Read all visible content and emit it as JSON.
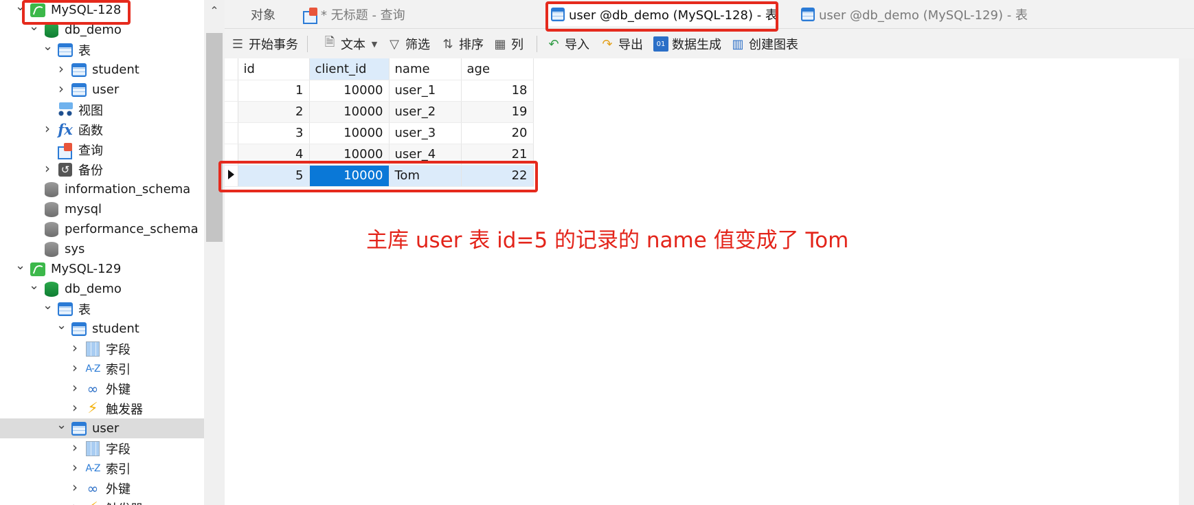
{
  "sidebar": {
    "nodes": [
      {
        "label": "MySQL-128",
        "icon": "mysql-server-icon",
        "chevron": "expanded"
      },
      {
        "label": "db_demo",
        "icon": "database-icon",
        "chevron": "expanded"
      },
      {
        "label": "表",
        "icon": "tables-folder-icon",
        "chevron": "expanded"
      },
      {
        "label": "student",
        "icon": "table-icon",
        "chevron": "collapsed"
      },
      {
        "label": "user",
        "icon": "table-icon",
        "chevron": "collapsed"
      },
      {
        "label": "视图",
        "icon": "views-folder-icon",
        "chevron": ""
      },
      {
        "label": "函数",
        "icon": "function-icon",
        "chevron": "collapsed"
      },
      {
        "label": "查询",
        "icon": "query-icon",
        "chevron": ""
      },
      {
        "label": "备份",
        "icon": "backup-icon",
        "chevron": "collapsed"
      },
      {
        "label": "information_schema",
        "icon": "database-icon-grey",
        "chevron": ""
      },
      {
        "label": "mysql",
        "icon": "database-icon-grey",
        "chevron": ""
      },
      {
        "label": "performance_schema",
        "icon": "database-icon-grey",
        "chevron": ""
      },
      {
        "label": "sys",
        "icon": "database-icon-grey",
        "chevron": ""
      },
      {
        "label": "MySQL-129",
        "icon": "mysql-server-icon",
        "chevron": "expanded"
      },
      {
        "label": "db_demo",
        "icon": "database-icon",
        "chevron": "expanded"
      },
      {
        "label": "表",
        "icon": "tables-folder-icon",
        "chevron": "expanded"
      },
      {
        "label": "student",
        "icon": "table-icon",
        "chevron": "expanded"
      },
      {
        "label": "字段",
        "icon": "fields-icon",
        "chevron": "collapsed"
      },
      {
        "label": "索引",
        "icon": "index-icon",
        "chevron": "collapsed"
      },
      {
        "label": "外键",
        "icon": "foreign-key-icon",
        "chevron": "collapsed"
      },
      {
        "label": "触发器",
        "icon": "trigger-icon",
        "chevron": "collapsed"
      },
      {
        "label": "user",
        "icon": "table-icon",
        "chevron": "expanded",
        "selected": true
      },
      {
        "label": "字段",
        "icon": "fields-icon",
        "chevron": "collapsed"
      },
      {
        "label": "索引",
        "icon": "index-icon",
        "chevron": "collapsed"
      },
      {
        "label": "外键",
        "icon": "foreign-key-icon",
        "chevron": "collapsed"
      },
      {
        "label": "触发器",
        "icon": "trigger-icon",
        "chevron": "collapsed"
      }
    ],
    "az_glyph": "A-Z"
  },
  "tabs": {
    "objects": "对象",
    "untitled_query": "* 无标题 - 查询",
    "user_128": "user @db_demo (MySQL-128) - 表",
    "user_129": "user @db_demo (MySQL-129) - 表"
  },
  "toolbar": {
    "begin_transaction": "开始事务",
    "text": "文本",
    "filter": "筛选",
    "sort": "排序",
    "columns": "列",
    "import": "导入",
    "export": "导出",
    "data_generation": "数据生成",
    "create_chart": "创建图表"
  },
  "grid": {
    "columns": [
      "id",
      "client_id",
      "name",
      "age"
    ],
    "rows": [
      [
        "1",
        "10000",
        "user_1",
        "18"
      ],
      [
        "2",
        "10000",
        "user_2",
        "19"
      ],
      [
        "3",
        "10000",
        "user_3",
        "20"
      ],
      [
        "4",
        "10000",
        "user_4",
        "21"
      ],
      [
        "5",
        "10000",
        "Tom",
        "22"
      ]
    ],
    "current_row": 4,
    "active_column": 1
  },
  "annotation": "主库 user 表 id=5 的记录的 name 值变成了 Tom",
  "colors": {
    "highlight_red": "#e52a1d",
    "annotation_red": "#e3241a",
    "active_cell_blue": "#0a78d7",
    "selected_row_blue": "#dcebfa",
    "mysql_green": "#3cb84a"
  }
}
